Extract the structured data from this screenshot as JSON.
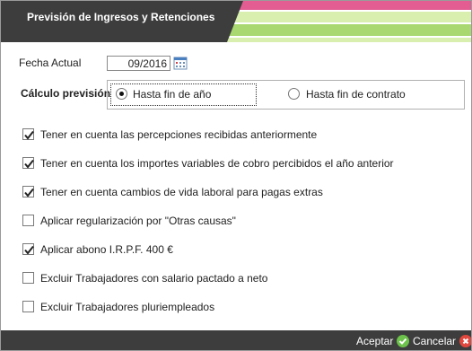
{
  "dialog": {
    "title": "Previsión de Ingresos y Retenciones",
    "colors": {
      "header_dark": "#3d3d3d",
      "stripe_pink": "#e35d93",
      "stripe_green": "#a8d86f",
      "stripe_lightgreen": "#d9efb0"
    }
  },
  "date": {
    "label": "Fecha Actual",
    "value": "09/2016",
    "icon": "calendar-icon"
  },
  "calc": {
    "label": "Cálculo previsión",
    "options": [
      {
        "label": "Hasta fin de año",
        "selected": true
      },
      {
        "label": "Hasta fin de contrato",
        "selected": false
      }
    ]
  },
  "options": [
    {
      "label": "Tener en cuenta las percepciones recibidas anteriormente",
      "checked": true
    },
    {
      "label": "Tener en cuenta los importes variables de cobro percibidos el año anterior",
      "checked": true
    },
    {
      "label": "Tener en cuenta cambios de vida laboral para pagas extras",
      "checked": true
    },
    {
      "label": "Aplicar regularización por \"Otras causas\"",
      "checked": false
    },
    {
      "label": "Aplicar abono I.R.P.F. 400 €",
      "checked": true
    },
    {
      "label": "Excluir Trabajadores con salario pactado a neto",
      "checked": false
    },
    {
      "label": "Excluir Trabajadores pluriempleados",
      "checked": false
    }
  ],
  "footer": {
    "accept_label": "Aceptar",
    "cancel_label": "Cancelar",
    "accept_icon": "check-circle-icon",
    "cancel_icon": "close-circle-icon"
  }
}
